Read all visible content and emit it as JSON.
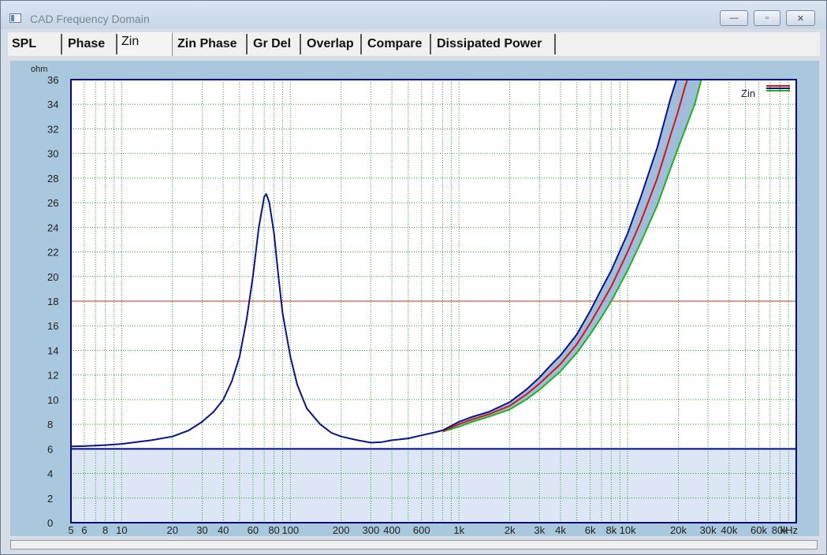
{
  "window": {
    "title": "CAD Frequency Domain",
    "minimize_glyph": "—",
    "maximize_glyph": "▫",
    "close_glyph": "✕"
  },
  "tabs": [
    {
      "label": "SPL",
      "active": false
    },
    {
      "label": "Phase",
      "active": false
    },
    {
      "label": "Zin",
      "active": true
    },
    {
      "label": "Zin Phase",
      "active": false
    },
    {
      "label": "Gr Del",
      "active": false
    },
    {
      "label": "Overlap",
      "active": false
    },
    {
      "label": "Compare",
      "active": false
    },
    {
      "label": "Dissipated Power",
      "active": false
    }
  ],
  "chart_data": {
    "type": "line",
    "ylabel": "ohm",
    "xunit": "kHz",
    "xscale": "log",
    "xlim": [
      5,
      100000
    ],
    "ylim": [
      0,
      36
    ],
    "yticks": [
      0,
      2,
      4,
      6,
      8,
      10,
      12,
      14,
      16,
      18,
      20,
      22,
      24,
      26,
      28,
      30,
      32,
      34,
      36
    ],
    "xticks": [
      {
        "v": 5,
        "label": "5"
      },
      {
        "v": 6,
        "label": "6"
      },
      {
        "v": 8,
        "label": "8"
      },
      {
        "v": 10,
        "label": "10"
      },
      {
        "v": 20,
        "label": "20"
      },
      {
        "v": 30,
        "label": "30"
      },
      {
        "v": 40,
        "label": "40"
      },
      {
        "v": 60,
        "label": "60"
      },
      {
        "v": 80,
        "label": "80"
      },
      {
        "v": 100,
        "label": "100"
      },
      {
        "v": 200,
        "label": "200"
      },
      {
        "v": 300,
        "label": "300"
      },
      {
        "v": 400,
        "label": "400"
      },
      {
        "v": 600,
        "label": "600"
      },
      {
        "v": 1000,
        "label": "1k"
      },
      {
        "v": 2000,
        "label": "2k"
      },
      {
        "v": 3000,
        "label": "3k"
      },
      {
        "v": 4000,
        "label": "4k"
      },
      {
        "v": 6000,
        "label": "6k"
      },
      {
        "v": 8000,
        "label": "8k"
      },
      {
        "v": 10000,
        "label": "10k"
      },
      {
        "v": 20000,
        "label": "20k"
      },
      {
        "v": 30000,
        "label": "30k"
      },
      {
        "v": 40000,
        "label": "40k"
      },
      {
        "v": 60000,
        "label": "60k"
      },
      {
        "v": 80000,
        "label": "80k"
      }
    ],
    "grid": true,
    "legend": {
      "label": "Zin",
      "placement": "top-right"
    },
    "reference_lines": [
      {
        "y": 18,
        "color": "#e02020"
      },
      {
        "y": 6,
        "color": "#000a8a"
      }
    ],
    "band_below_y": 6,
    "band_color": "#dce6f5",
    "spread_fill_color": "#8fb3d6",
    "series": [
      {
        "color": "#0b128a",
        "points": [
          [
            5,
            6.2
          ],
          [
            6,
            6.22
          ],
          [
            8,
            6.3
          ],
          [
            10,
            6.4
          ],
          [
            15,
            6.7
          ],
          [
            20,
            7.0
          ],
          [
            25,
            7.5
          ],
          [
            30,
            8.2
          ],
          [
            35,
            9.0
          ],
          [
            40,
            10.0
          ],
          [
            45,
            11.5
          ],
          [
            50,
            13.5
          ],
          [
            55,
            16.5
          ],
          [
            60,
            20.0
          ],
          [
            65,
            24.0
          ],
          [
            70,
            26.5
          ],
          [
            72,
            26.7
          ],
          [
            75,
            26.0
          ],
          [
            80,
            23.5
          ],
          [
            85,
            20.0
          ],
          [
            90,
            17.0
          ],
          [
            100,
            13.5
          ],
          [
            110,
            11.2
          ],
          [
            125,
            9.3
          ],
          [
            150,
            8.0
          ],
          [
            175,
            7.3
          ],
          [
            200,
            7.0
          ],
          [
            250,
            6.7
          ],
          [
            300,
            6.5
          ],
          [
            350,
            6.55
          ],
          [
            400,
            6.7
          ],
          [
            500,
            6.85
          ],
          [
            600,
            7.1
          ],
          [
            700,
            7.3
          ],
          [
            800,
            7.5
          ],
          [
            1000,
            8.2
          ],
          [
            1200,
            8.6
          ],
          [
            1500,
            9.0
          ],
          [
            2000,
            9.8
          ],
          [
            2500,
            10.8
          ],
          [
            3000,
            11.8
          ],
          [
            3500,
            12.8
          ],
          [
            4000,
            13.6
          ],
          [
            5000,
            15.3
          ],
          [
            6000,
            17.2
          ],
          [
            7000,
            19.0
          ],
          [
            8000,
            20.5
          ],
          [
            10000,
            23.5
          ],
          [
            12000,
            26.5
          ],
          [
            15000,
            30.5
          ],
          [
            18000,
            34.5
          ],
          [
            20000,
            36.5
          ]
        ]
      },
      {
        "color": "#d01818",
        "points": [
          [
            800,
            7.45
          ],
          [
            1000,
            8.0
          ],
          [
            1200,
            8.4
          ],
          [
            1500,
            8.8
          ],
          [
            2000,
            9.5
          ],
          [
            2500,
            10.4
          ],
          [
            3000,
            11.3
          ],
          [
            4000,
            12.9
          ],
          [
            5000,
            14.5
          ],
          [
            6000,
            16.2
          ],
          [
            7000,
            17.8
          ],
          [
            8000,
            19.2
          ],
          [
            10000,
            22.0
          ],
          [
            12000,
            24.5
          ],
          [
            15000,
            28.0
          ],
          [
            18000,
            31.5
          ],
          [
            20000,
            33.5
          ],
          [
            22000,
            35.5
          ],
          [
            24000,
            37.0
          ]
        ]
      },
      {
        "color": "#1fb21f",
        "points": [
          [
            800,
            7.4
          ],
          [
            1000,
            7.8
          ],
          [
            1200,
            8.2
          ],
          [
            1500,
            8.6
          ],
          [
            2000,
            9.2
          ],
          [
            2500,
            10.0
          ],
          [
            3000,
            10.8
          ],
          [
            4000,
            12.3
          ],
          [
            5000,
            13.8
          ],
          [
            6000,
            15.3
          ],
          [
            7000,
            16.7
          ],
          [
            8000,
            18.0
          ],
          [
            10000,
            20.5
          ],
          [
            12000,
            22.8
          ],
          [
            15000,
            25.8
          ],
          [
            18000,
            28.8
          ],
          [
            20000,
            30.5
          ],
          [
            25000,
            34.0
          ],
          [
            28000,
            36.5
          ]
        ]
      }
    ]
  }
}
